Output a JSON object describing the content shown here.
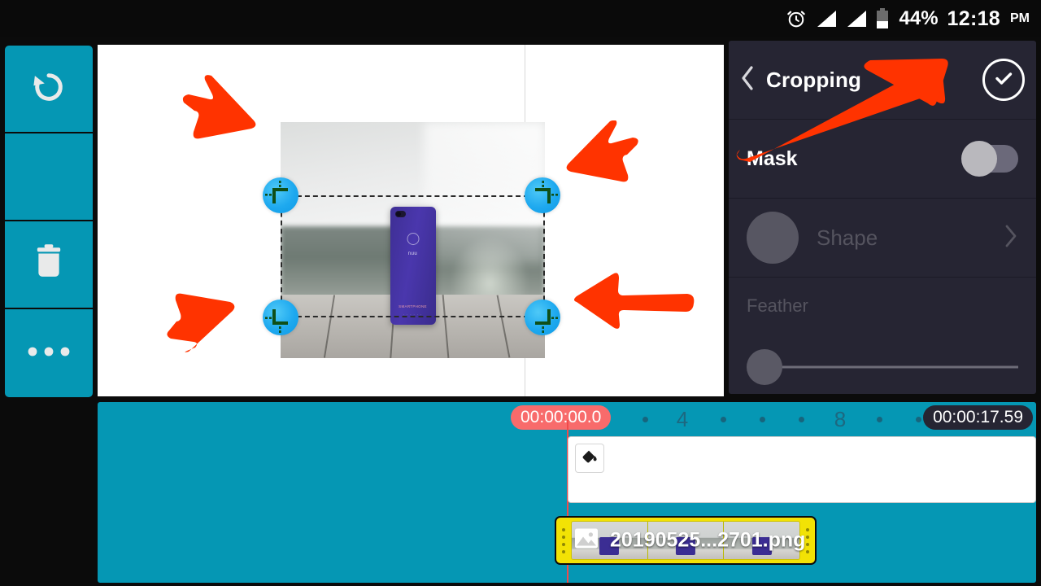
{
  "statusbar": {
    "alarm_icon": "alarm-clock-icon",
    "signal_icon_1": "signal-bars-icon",
    "signal_icon_2": "signal-bars-icon",
    "battery_icon": "battery-icon",
    "battery_percent": "44%",
    "time": "12:18",
    "meridiem": "PM"
  },
  "toolrail": {
    "items": [
      {
        "name": "undo-button",
        "icon": "undo-icon"
      },
      {
        "name": "empty-slot",
        "icon": "none"
      },
      {
        "name": "delete-button",
        "icon": "trash-icon"
      },
      {
        "name": "more-button",
        "icon": "more-horizontal-icon"
      },
      {
        "name": "expand-button",
        "icon": "expand-vertical-icon"
      },
      {
        "name": "pin-button",
        "icon": "pushpin-icon"
      }
    ]
  },
  "panel": {
    "title": "Cropping",
    "back_icon": "chevron-left-icon",
    "confirm_icon": "check-circle-icon",
    "mask": {
      "label": "Mask",
      "enabled": false
    },
    "shape": {
      "label": "Shape",
      "chevron": "chevron-right-icon",
      "disabled": true
    },
    "feather": {
      "label": "Feather",
      "value": 0,
      "disabled": true
    }
  },
  "timeline": {
    "current_time": "00:00:00.0",
    "total_time": "00:00:17.59",
    "tick_labels": [
      "4",
      "8"
    ],
    "fill_icon": "paint-bucket-icon",
    "clip": {
      "name": "20190525...2701.png",
      "icon": "image-icon"
    }
  },
  "annotations": {
    "arrow_tl": "arrow-down-right",
    "arrow_tr": "arrow-down-left",
    "arrow_bl": "arrow-up-right",
    "arrow_br": "arrow-left",
    "arrow_panel": "arrow-up-right-long"
  },
  "colors": {
    "teal": "#0597b4",
    "panel_bg": "#262533",
    "annotation": "#ff3300",
    "clip_yellow": "#f2e205",
    "playhead": "#f04b4b",
    "current_pill": "#f86b6b",
    "handle_blue": "#1ea9ef"
  }
}
